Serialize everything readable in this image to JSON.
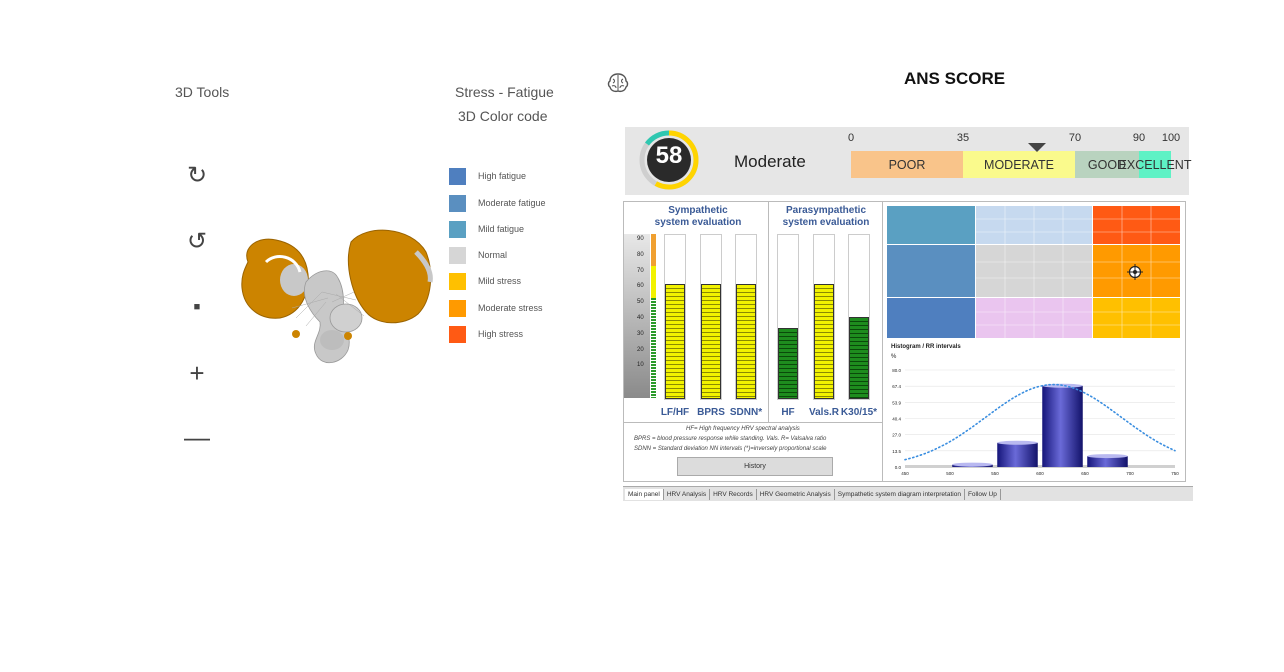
{
  "tools": {
    "title": "3D Tools",
    "items": [
      {
        "name": "rotate-right-icon",
        "glyph": "↻"
      },
      {
        "name": "rotate-left-icon",
        "glyph": "↺"
      },
      {
        "name": "stop-icon",
        "glyph": "■"
      },
      {
        "name": "zoom-in-icon",
        "glyph": "+"
      },
      {
        "name": "zoom-out-icon",
        "glyph": "—"
      }
    ]
  },
  "legend": {
    "title1": "Stress - Fatigue",
    "title2": "3D Color code",
    "items": [
      {
        "label": "High fatigue",
        "color": "#4f7fbf"
      },
      {
        "label": "Moderate fatigue",
        "color": "#5a8fc0"
      },
      {
        "label": "Mild fatigue",
        "color": "#5aa0c2"
      },
      {
        "label": "Normal",
        "color": "#d6d6d6"
      },
      {
        "label": "Mild stress",
        "color": "#ffc000"
      },
      {
        "label": "Moderate stress",
        "color": "#ff9a00"
      },
      {
        "label": "High stress",
        "color": "#ff5a14"
      }
    ]
  },
  "ans": {
    "title": "ANS SCORE",
    "score": "58",
    "score_value": 58,
    "level": "Moderate",
    "ticks": [
      {
        "label": "0",
        "value": 0
      },
      {
        "label": "35",
        "value": 35
      },
      {
        "label": "70",
        "value": 70
      },
      {
        "label": "90",
        "value": 90
      },
      {
        "label": "100",
        "value": 100
      }
    ],
    "segments": [
      {
        "label": "POOR",
        "from": 0,
        "to": 35,
        "color": "#f9c48a"
      },
      {
        "label": "MODERATE",
        "from": 35,
        "to": 70,
        "color": "#fafa8c"
      },
      {
        "label": "GOOD",
        "from": 70,
        "to": 90,
        "color": "#b9d3bf"
      },
      {
        "label": "EXCELLENT",
        "from": 90,
        "to": 100,
        "color": "#5ef2c5"
      }
    ]
  },
  "sympathetic": {
    "title_line1": "Sympathetic",
    "title_line2": "system evaluation",
    "axis": [
      "90",
      "80",
      "70",
      "60",
      "50",
      "40",
      "30",
      "20",
      "10"
    ],
    "bars": [
      {
        "label": "LF/HF",
        "value": 70,
        "color": "#f2f200"
      },
      {
        "label": "BPRS",
        "value": 70,
        "color": "#f2f200"
      },
      {
        "label": "SDNN*",
        "value": 70,
        "color": "#f2f200"
      }
    ]
  },
  "parasympathetic": {
    "title_line1": "Parasympathetic",
    "title_line2": "system evaluation",
    "bars": [
      {
        "label": "HF",
        "value": 43,
        "color": "#1e8c1e"
      },
      {
        "label": "Vals.R",
        "value": 70,
        "color": "#f2f200"
      },
      {
        "label": "K30/15*",
        "value": 50,
        "color": "#1e8c1e"
      }
    ]
  },
  "notes": {
    "line1": "HF= High frequency HRV spectral analysis",
    "line2": "BPRS = blood pressure response while standing.  Vals. R= Valsalva ratio",
    "line3": "SDNN = Standard deviation NN intervals        (*)=inversely proportional scale",
    "history_button": "History"
  },
  "histogram": {
    "title": "Histogram / RR intervals",
    "y_unit": "%",
    "chart_data": {
      "type": "bar",
      "x": [
        525,
        575,
        625,
        675
      ],
      "values": [
        2,
        20,
        67,
        9
      ],
      "xlim": [
        450,
        750
      ],
      "ylim": [
        0,
        80
      ],
      "xticks": [
        "450",
        "500",
        "550",
        "600",
        "650",
        "700",
        "750"
      ],
      "yticks": [
        "80.0",
        "67.4",
        "53.9",
        "40.4",
        "27.0",
        "13.5",
        "0.0"
      ]
    }
  },
  "tabs": [
    "Main panel",
    "HRV Analysis",
    "HRV Records",
    "HRV Geometric Analysis",
    "Sympathetic system diagram interpretation",
    "Follow Up"
  ],
  "colors": {
    "brain_orange": "#cc8400",
    "brain_gray": "#c8c8c8"
  }
}
